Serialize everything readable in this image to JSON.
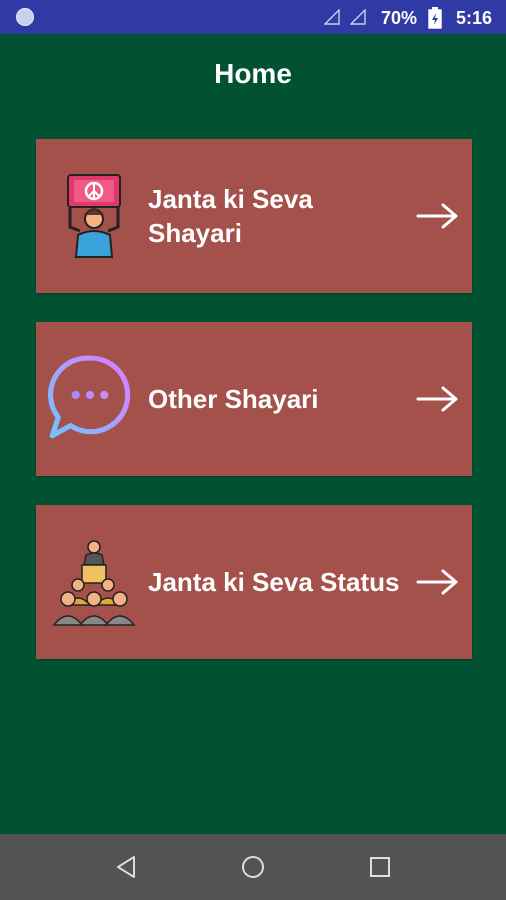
{
  "status_bar": {
    "battery_percent": "70%",
    "time": "5:16",
    "icons": [
      "notification-dot-icon",
      "signal-empty-icon",
      "signal-empty-icon",
      "battery-charging-icon"
    ]
  },
  "header": {
    "title": "Home"
  },
  "menu": {
    "items": [
      {
        "label": "Janta ki Seva Shayari",
        "icon": "protester-sign-icon",
        "arrow": "arrow-right-icon"
      },
      {
        "label": "Other Shayari",
        "icon": "chat-bubble-icon",
        "arrow": "arrow-right-icon"
      },
      {
        "label": "Janta ki Seva Status",
        "icon": "speaker-crowd-icon",
        "arrow": "arrow-right-icon"
      }
    ]
  },
  "nav_bar": {
    "buttons": [
      "back-icon",
      "home-icon",
      "recent-apps-icon"
    ]
  },
  "colors": {
    "background": "#005232",
    "card": "#a4504b",
    "status_bar": "#2f3aa5",
    "nav_bar": "#535353",
    "text": "#ffffff"
  }
}
